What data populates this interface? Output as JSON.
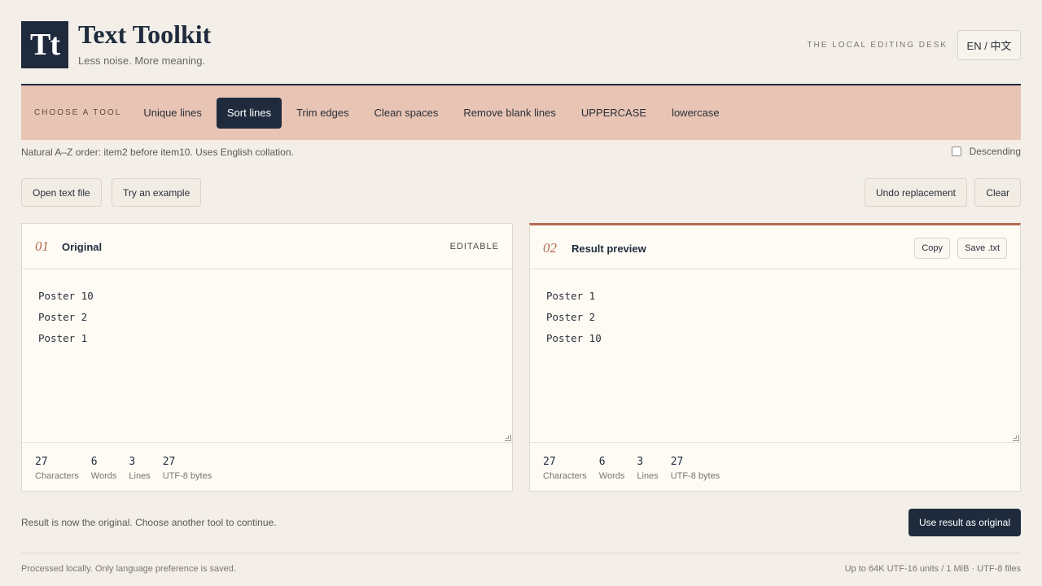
{
  "header": {
    "logo_text": "Tt",
    "title": "Text Toolkit",
    "tagline": "Less noise. More meaning.",
    "desk_label": "THE LOCAL EDITING DESK",
    "language_button": "EN / 中文"
  },
  "toolbar": {
    "label": "CHOOSE A TOOL",
    "tools": [
      {
        "label": "Unique lines",
        "active": false
      },
      {
        "label": "Sort lines",
        "active": true
      },
      {
        "label": "Trim edges",
        "active": false
      },
      {
        "label": "Clean spaces",
        "active": false
      },
      {
        "label": "Remove blank lines",
        "active": false
      },
      {
        "label": "UPPERCASE",
        "active": false
      },
      {
        "label": "lowercase",
        "active": false
      }
    ]
  },
  "options": {
    "hint": "Natural A–Z order: item2 before item10. Uses English collation.",
    "descending_label": "Descending",
    "descending_checked": false
  },
  "actions": {
    "open_file": "Open text file",
    "try_example": "Try an example",
    "undo": "Undo replacement",
    "clear": "Clear"
  },
  "original": {
    "number": "01",
    "title": "Original",
    "badge": "EDITABLE",
    "lines": [
      "Poster 10",
      "Poster 2",
      "Poster 1"
    ],
    "stats": {
      "characters": "27",
      "words": "6",
      "lines": "3",
      "bytes": "27"
    }
  },
  "result": {
    "number": "02",
    "title": "Result preview",
    "copy": "Copy",
    "save": "Save .txt",
    "lines": [
      "Poster 1",
      "Poster 2",
      "Poster 10"
    ],
    "stats": {
      "characters": "27",
      "words": "6",
      "lines": "3",
      "bytes": "27"
    }
  },
  "stat_labels": {
    "characters": "Characters",
    "words": "Words",
    "lines": "Lines",
    "bytes": "UTF-8 bytes"
  },
  "status": {
    "message": "Result is now the original. Choose another tool to continue.",
    "use_result": "Use result as original"
  },
  "footer": {
    "left": "Processed locally. Only language preference is saved.",
    "right": "Up to 64K UTF-16 units / 1 MiB · UTF-8 files"
  },
  "colors": {
    "primary": "#1f2b3d",
    "accent": "#b86a52",
    "toolbar_bg": "#e8c4b4",
    "page_bg": "#f3efe8"
  }
}
